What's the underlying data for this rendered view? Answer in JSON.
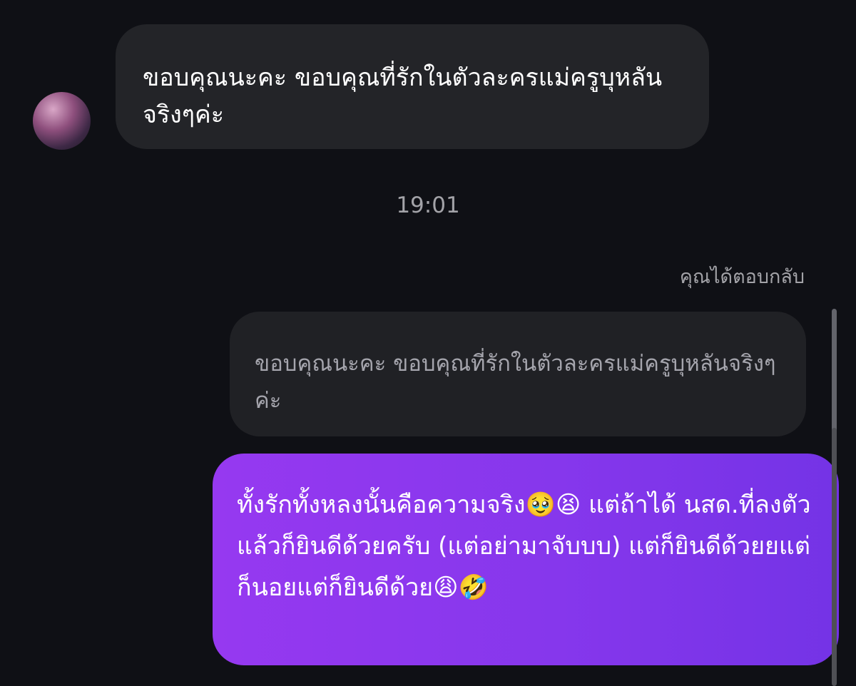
{
  "messages": {
    "incoming": "ขอบคุณนะคะ ขอบคุณที่รักในตัวละครแม่ครูบุหลันจริงๆค่ะ",
    "timestamp": "19:01",
    "reply_label": "คุณได้ตอบกลับ",
    "quoted": "ขอบคุณนะคะ ขอบคุณที่รักในตัวละครแม่ครูบุหลันจริงๆค่ะ",
    "outgoing": "ทั้งรักทั้งหลงนั้นคือความจริง🥹😫 แต่ถ้าได้ นสด.ที่ลงตัวแล้วก็ยินดีด้วยครับ (แต่อย่ามาจับบบ) แต่ก็ยินดีด้วยยแต่ก็นอยแต่ก็ยินดีด้วย😩🤣"
  },
  "colors": {
    "background": "#0f1015",
    "incoming_bubble": "#232428",
    "quoted_bubble": "#202125",
    "outgoing_bubble": "#8637ec",
    "meta_text": "#a3a3a8"
  }
}
